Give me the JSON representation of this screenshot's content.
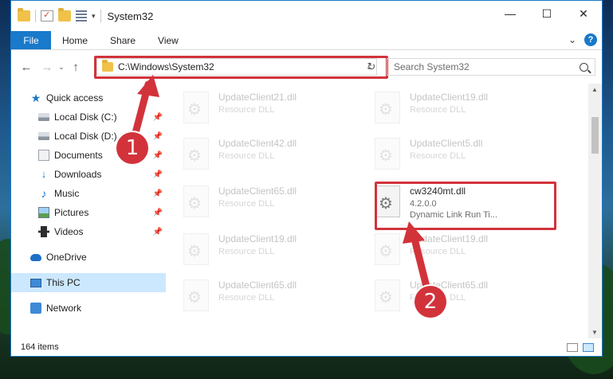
{
  "window": {
    "title": "System32"
  },
  "ribbon": {
    "file": "File",
    "tabs": [
      "Home",
      "Share",
      "View"
    ],
    "help": "?"
  },
  "controls": {
    "minimize": "—",
    "maximize": "☐",
    "close": "✕",
    "expand": "⌄"
  },
  "nav": {
    "back": "←",
    "forward": "→",
    "dropdown": "⌄",
    "up": "↑"
  },
  "address": {
    "path": "C:\\Windows\\System32",
    "refresh": "↻",
    "chevron": "⌄"
  },
  "search": {
    "placeholder": "Search System32"
  },
  "sidebar": {
    "items": [
      {
        "label": "Quick access",
        "icon": "star-icon"
      },
      {
        "label": "Local Disk (C:)",
        "icon": "disk-icon",
        "pinned": true
      },
      {
        "label": "Local Disk (D:)",
        "icon": "disk-icon",
        "pinned": true
      },
      {
        "label": "Documents",
        "icon": "documents-icon",
        "pinned": true
      },
      {
        "label": "Downloads",
        "icon": "downloads-icon",
        "pinned": true
      },
      {
        "label": "Music",
        "icon": "music-icon",
        "pinned": true
      },
      {
        "label": "Pictures",
        "icon": "pictures-icon",
        "pinned": true
      },
      {
        "label": "Videos",
        "icon": "videos-icon",
        "pinned": true
      },
      {
        "label": "OneDrive",
        "icon": "onedrive-icon"
      },
      {
        "label": "This PC",
        "icon": "this-pc-icon",
        "selected": true
      },
      {
        "label": "Network",
        "icon": "network-icon"
      }
    ]
  },
  "files": {
    "left": [
      {
        "name": "UpdateClient21.dll",
        "desc": "Resource DLL"
      },
      {
        "name": "UpdateClient42.dll",
        "desc": "Resource DLL"
      },
      {
        "name": "UpdateClient65.dll",
        "desc": "Resource DLL"
      },
      {
        "name": "UpdateClient19.dll",
        "desc": "Resource DLL"
      },
      {
        "name": "UpdateClient65.dll",
        "desc": "Resource DLL"
      }
    ],
    "right": [
      {
        "name": "UpdateClient19.dll",
        "desc": "Resource DLL"
      },
      {
        "name": "UpdateClient5.dll",
        "desc": "Resource DLL"
      },
      {
        "name": "cw3240mt.dll",
        "version": "4.2.0.0",
        "desc": "Dynamic Link Run Ti..."
      },
      {
        "name": "UpdateClient19.dll",
        "desc": "Resource DLL"
      },
      {
        "name": "UpdateClient65.dll",
        "desc": "Resource DLL"
      }
    ]
  },
  "status": {
    "count": "164 items"
  },
  "annotations": {
    "step1": "1",
    "step2": "2",
    "accent": "#d2333b"
  },
  "colors": {
    "accent": "#1979ca",
    "selection": "#cce8ff"
  }
}
